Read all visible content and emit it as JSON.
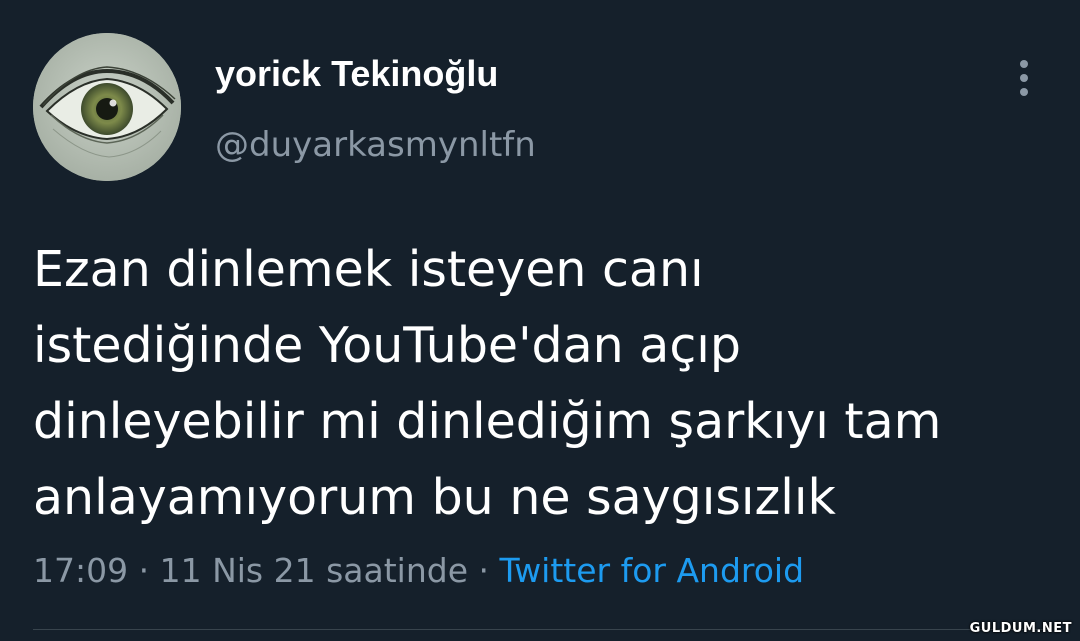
{
  "tweet": {
    "author": {
      "display_name": "yorick Tekinoğlu",
      "handle": "@duyarkasmynltfn",
      "avatar_icon": "eye-photo"
    },
    "more_icon": "more-vertical-icon",
    "text_lines": [
      "Ezan dinlemek isteyen canı",
      "istediğinde YouTube'dan açıp",
      "dinleyebilir mi dinlediğim şarkıyı tam",
      "anlayamıyorum bu ne saygısızlık"
    ],
    "meta": {
      "time": "17:09",
      "separator": " · ",
      "date": "11 Nis 21 saatinde",
      "source": "Twitter for Android"
    }
  },
  "watermark": "GULDUM.NET",
  "colors": {
    "background": "#15202b",
    "primary_text": "#ffffff",
    "secondary_text": "#8b98a5",
    "link": "#1d9bf0",
    "divider": "#38444d"
  }
}
